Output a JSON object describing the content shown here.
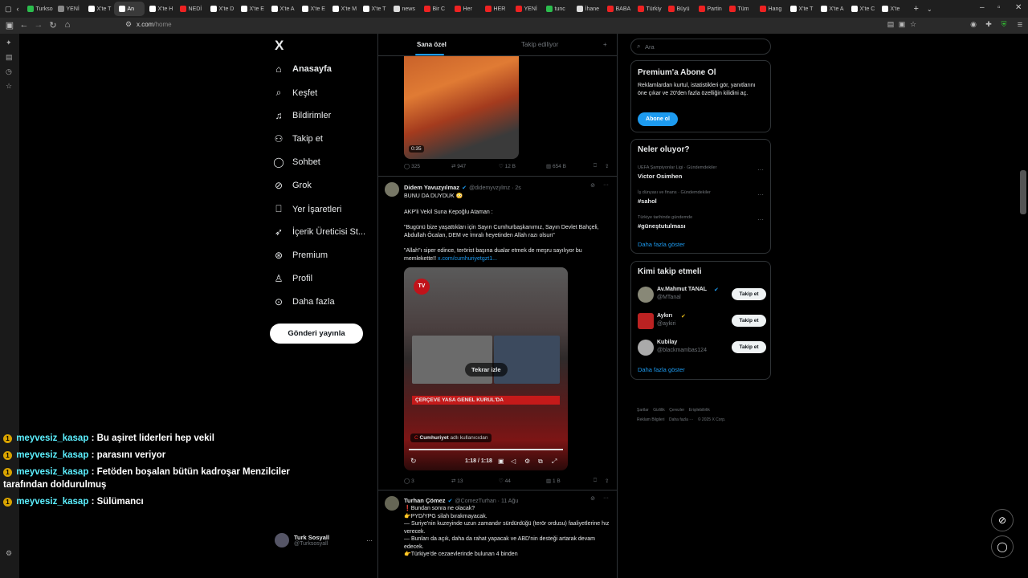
{
  "browser": {
    "tabs": [
      "Turkso",
      "YENİ",
      "X'te T",
      "An",
      "X'te H",
      "NEDİ",
      "X'te D",
      "X'te E",
      "X'te A",
      "X'te E",
      "X'te M",
      "X'te T",
      "news",
      "Bir C",
      "Her",
      "HER",
      "YENİ",
      "tunc",
      "İhane",
      "BABA",
      "Türkiy",
      "Büyü",
      "Partin",
      "Tüm",
      "Hang",
      "X'te T",
      "X'te A",
      "X'te C",
      "X'te"
    ],
    "active_tab_index": 3,
    "url_host": "x.com",
    "url_path": "/home"
  },
  "chat": [
    {
      "badge": "1",
      "user": "meyvesiz_kasap",
      "text": ": Bu aşiret liderleri hep vekil"
    },
    {
      "badge": "1",
      "user": "meyvesiz_kasap",
      "text": ": parasını veriyor"
    },
    {
      "badge": "1",
      "user": "meyvesiz_kasap",
      "text": ": Fetöden boşalan bütün kadroşar Menzilciler tarafından doldurulmuş"
    },
    {
      "badge": "1",
      "user": "meyvesiz_kasap",
      "text": ": Sülümancı"
    }
  ],
  "nav": {
    "logo": "X",
    "items": [
      "Anasayfa",
      "Keşfet",
      "Bildirimler",
      "Takip et",
      "Sohbet",
      "Grok",
      "Yer İşaretleri",
      "İçerik Üreticisi St...",
      "Premium",
      "Profil",
      "Daha fazla"
    ],
    "post_button": "Gönderi yayınla",
    "account_name": "Turk Sosyall",
    "account_handle": "@Turksosyall"
  },
  "feed": {
    "tabs": [
      "Sana özel",
      "Takip ediliyor"
    ],
    "tweet1": {
      "duration": "0:35",
      "replies": "325",
      "retweets": "947",
      "likes": "12 B",
      "views": "654 B"
    },
    "tweet2": {
      "name": "Didem Yavuzyılmaz",
      "handle": "@didemyvzylmz · 2s",
      "line1": "BUNU DA DUYDUK 😳",
      "p1": "AKP'li Vekil Suna Kepoğlu Ataman :",
      "p2": "\"Bugünü bize yaşattıkları için Sayın Cumhurbaşkanımız, Sayın Devlet Bahçeli, Abdullah Öcalan, DEM ve İmralı heyetinden Allah razı olsun\"",
      "p3": "\"Allah\"ı siper edince, terörist başına dualar etmek de meşru sayılıyor bu memlekette!!",
      "link": "x.com/cumhuriyetgzt1...",
      "replay": "Tekrar izle",
      "lower_title": "ÇERÇEVE YASA GENEL KURUL'DA",
      "source": "Cumhuriyet",
      "source_suffix": "adlı kullanıcıdan",
      "time": "1:18 / 1:18",
      "replies": "3",
      "retweets": "13",
      "likes": "44",
      "views": "1 B"
    },
    "tweet3": {
      "name": "Turhan Çömez",
      "handle": "@ComezTurhan · 11 Ağu",
      "lines": [
        "❗Bundan sonra ne olacak?",
        "👉PYD/YPG silah bırakmayacak.",
        "— Suriye'nin kuzeyinde uzun zamandır sürdürdüğü (terör ordusu) faaliyetlerine hız verecek.",
        "— Bunları da açık, daha da rahat yapacak ve ABD'nin desteği artarak devam edecek.",
        "👉Türkiye'de cezaevlerinde bulunan 4 binden"
      ]
    }
  },
  "right": {
    "search_placeholder": "Ara",
    "premium": {
      "title": "Premium'a Abone Ol",
      "text": "Reklamlardan kurtul, istatistikleri gör, yanıtlarını öne çıkar ve 20'den fazla özelliğin kilidini aç.",
      "button": "Abone ol"
    },
    "trends": {
      "title": "Neler oluyor?",
      "items": [
        {
          "meta": "UEFA Şampiyonlar Ligi · Gündemdekiler",
          "name": "Victor Osimhen"
        },
        {
          "meta": "İş dünyası ve finans · Gündemdekiler",
          "name": "#sahol"
        },
        {
          "meta": "Türkiye tarihinde gündemde",
          "name": "#güneştutulması"
        }
      ],
      "more": "Daha fazla göster"
    },
    "follow": {
      "title": "Kimi takip etmeli",
      "items": [
        {
          "name": "Av.Mahmut TANAL",
          "handle": "@MTanal"
        },
        {
          "name": "Aykırı",
          "handle": "@aykiri"
        },
        {
          "name": "Kubilay",
          "handle": "@blackmambas124"
        }
      ],
      "button": "Takip et",
      "more": "Daha fazla göster"
    },
    "footer": {
      "l1": "Şartlar    Gizlilik    Çerezler    Erişilebilirlik",
      "l2": "Reklam Bilgileri    Daha fazla ···    © 2025 X Corp."
    }
  }
}
